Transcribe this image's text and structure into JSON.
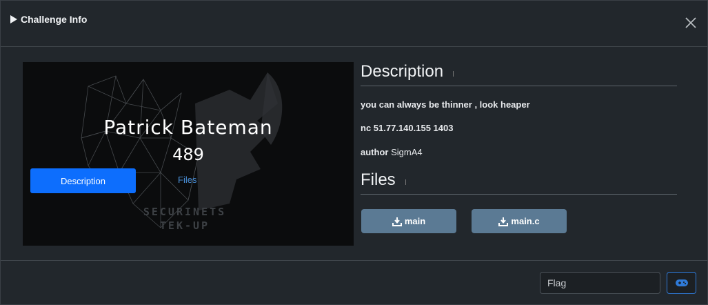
{
  "modal": {
    "title": "Challenge Info",
    "close_icon": "close-icon"
  },
  "challenge": {
    "name": "Patrick Bateman",
    "points": "489",
    "tabs": [
      {
        "label": "Description",
        "active": true
      },
      {
        "label": "Files",
        "active": false
      }
    ],
    "banner_text": [
      "SECURINETS",
      "TEK-UP"
    ]
  },
  "description": {
    "heading": "Description",
    "line1": "you can always be thinner , look heaper",
    "line2": "nc 51.77.140.155 1403",
    "author_label": "author",
    "author_value": "SigmA4"
  },
  "files": {
    "heading": "Files",
    "items": [
      {
        "label": "main",
        "icon": "download-icon"
      },
      {
        "label": "main.c",
        "icon": "download-icon"
      }
    ]
  },
  "submit": {
    "placeholder": "Flag",
    "button_icon": "gamepad-icon"
  },
  "colors": {
    "accent": "#0d6efd",
    "file_button": "#5b7a94",
    "modal_bg": "#22272c"
  }
}
